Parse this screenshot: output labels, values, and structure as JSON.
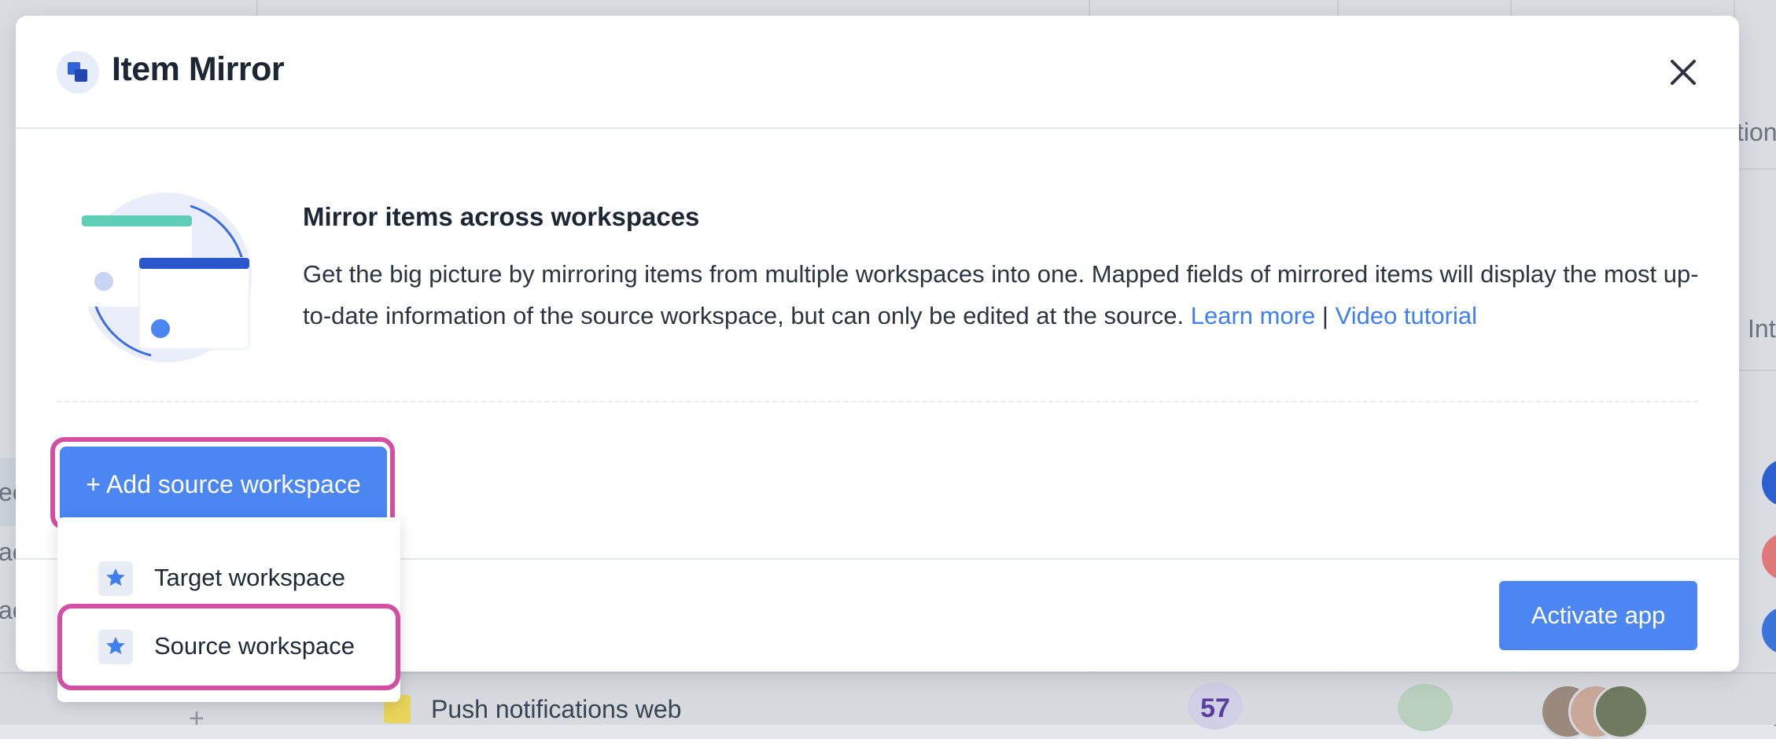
{
  "modal": {
    "title": "Item Mirror",
    "close_icon": "close-icon",
    "intro": {
      "heading": "Mirror items across workspaces",
      "description": "Get the big picture by mirroring items from multiple workspaces into one. Mapped fields of mirrored items will display the most up-to-date information of the source workspace, but can only be edited at the source.",
      "learn_more": "Learn more",
      "separator": "|",
      "video_tutorial": "Video tutorial"
    },
    "add_source_button": "+ Add source workspace",
    "activate_button": "Activate app"
  },
  "dropdown": {
    "items": [
      {
        "label": "Target workspace",
        "icon": "star-icon"
      },
      {
        "label": "Source workspace",
        "icon": "star-icon"
      }
    ]
  },
  "background": {
    "row_label": "Push notifications web",
    "count": "57",
    "partial_texts": [
      "tion",
      "Int",
      "ec",
      "ac",
      "ac"
    ]
  },
  "colors": {
    "accent": "#4b86f2",
    "highlight": "#d24fa4",
    "link": "#3f7ff0"
  }
}
